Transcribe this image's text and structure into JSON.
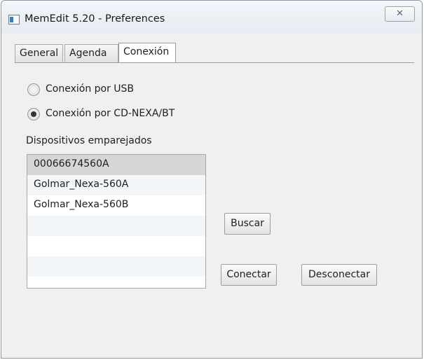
{
  "window": {
    "title": "MemEdit 5.20 - Preferences",
    "close_glyph": "✕"
  },
  "tabs": [
    {
      "label": "General",
      "active": false
    },
    {
      "label": "Agenda",
      "active": false
    },
    {
      "label": "Conexión",
      "active": true
    }
  ],
  "connection": {
    "radio_usb": {
      "label": "Conexión por USB",
      "checked": false
    },
    "radio_nexa": {
      "label": "Conexión por CD-NEXA/BT",
      "checked": true
    }
  },
  "devices": {
    "label": "Dispositivos emparejados",
    "items": [
      "00066674560A",
      "Golmar_Nexa-560A",
      "Golmar_Nexa-560B",
      "",
      "",
      ""
    ],
    "selected_index": 0
  },
  "buttons": {
    "search": "Buscar",
    "connect": "Conectar",
    "disconnect": "Desconectar"
  },
  "colors": {
    "row_selected": "#d6d6d6",
    "row_alt": "#f3f6f8",
    "row_normal": "#ffffff"
  }
}
